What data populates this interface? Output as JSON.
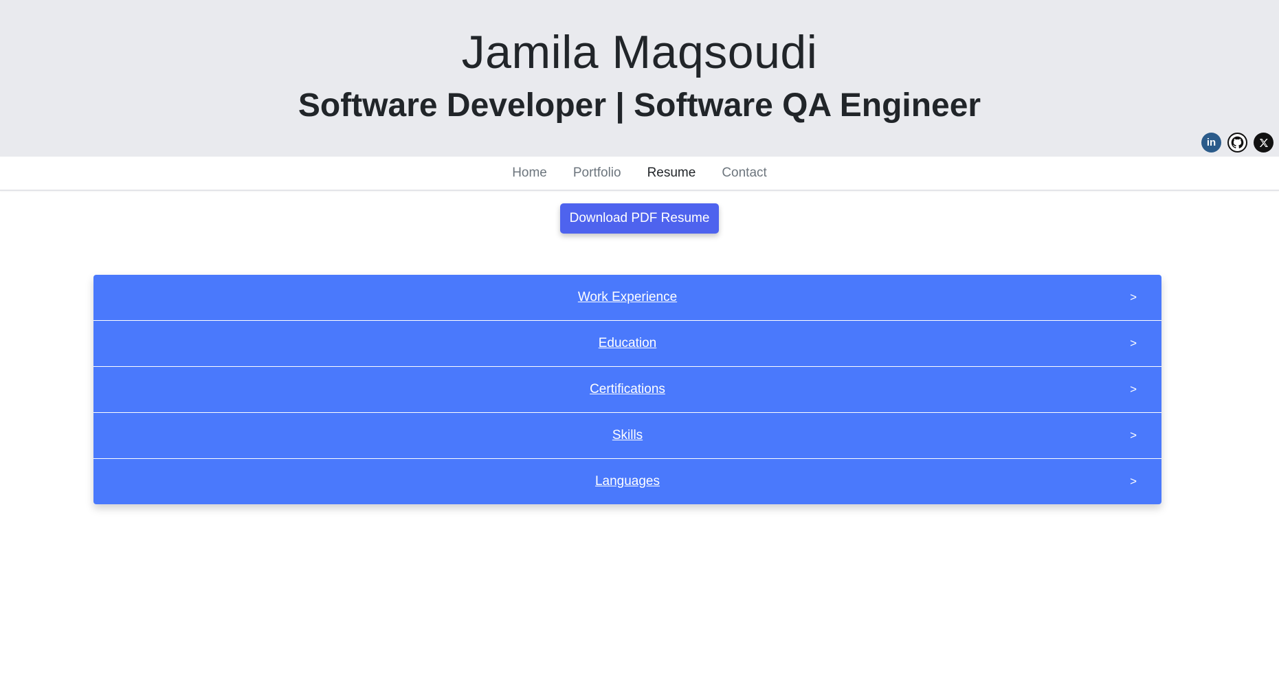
{
  "header": {
    "name": "Jamila Maqsoudi",
    "subtitle": "Software Developer | Software QA Engineer",
    "social": [
      {
        "icon": "linkedin-icon",
        "label": "in"
      },
      {
        "icon": "github-icon"
      },
      {
        "icon": "x-icon"
      }
    ]
  },
  "nav": {
    "items": [
      {
        "label": "Home",
        "active": false
      },
      {
        "label": "Portfolio",
        "active": false
      },
      {
        "label": "Resume",
        "active": true
      },
      {
        "label": "Contact",
        "active": false
      }
    ]
  },
  "download": {
    "label": "Download PDF Resume"
  },
  "accordion": {
    "items": [
      {
        "title": "Work Experience",
        "arrow": ">"
      },
      {
        "title": "Education",
        "arrow": ">"
      },
      {
        "title": "Certifications",
        "arrow": ">"
      },
      {
        "title": "Skills",
        "arrow": ">"
      },
      {
        "title": "Languages",
        "arrow": ">"
      }
    ]
  },
  "colors": {
    "header_bg": "#e9eaee",
    "accordion_bg": "#4a79fc",
    "button_bg": "#4e63ee"
  }
}
